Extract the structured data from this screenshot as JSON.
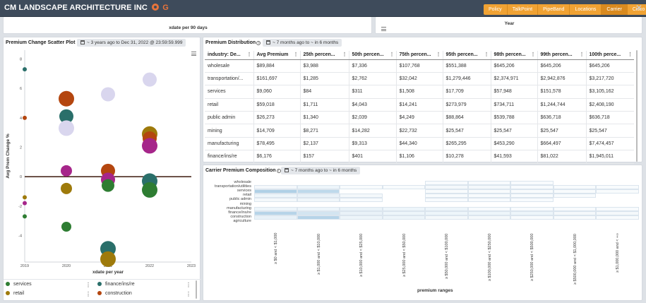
{
  "header": {
    "title": "CM LANDSCAPE ARCHITECTURE INC",
    "brand_icon": "orange-ring-logo",
    "brand_letter": "G",
    "tabs": [
      "Policy",
      "TalkPoint",
      "PipeBand",
      "Locations",
      "Carrier",
      "Cisco"
    ],
    "active_tab": "Carrier",
    "close": "✕"
  },
  "top_cards": {
    "left_axis_label": "xdate per 90 days",
    "right_axis_label": "Year"
  },
  "scatter": {
    "title": "Premium Change Scatter Plot",
    "date_range": "~ 3 years ago to Dec 31, 2022 @ 23:59:59.999",
    "legend": [
      {
        "label": "services",
        "color": "#2e7d32"
      },
      {
        "label": "finance/ins/re",
        "color": "#2a6f6a"
      },
      {
        "label": "retail",
        "color": "#9e7a0b"
      },
      {
        "label": "construction",
        "color": "#b4460f"
      }
    ]
  },
  "premium_distribution": {
    "title": "Premium Distribution",
    "date_range": "~ 7 months ago to ~ in 6 months",
    "columns": [
      "industry: De...",
      "Avg Premium",
      "25th percen...",
      "50th percen...",
      "75th percen...",
      "95th percen...",
      "98th percen...",
      "99th percen...",
      "100th perce..."
    ],
    "rows": [
      [
        "wholesale",
        "$89,884",
        "$3,988",
        "$7,336",
        "$107,768",
        "$551,388",
        "$645,206",
        "$645,206",
        "$645,206"
      ],
      [
        "transportation/...",
        "$161,697",
        "$1,285",
        "$2,762",
        "$32,042",
        "$1,279,446",
        "$2,374,971",
        "$2,942,876",
        "$3,217,720"
      ],
      [
        "services",
        "$9,060",
        "$84",
        "$311",
        "$1,508",
        "$17,709",
        "$57,948",
        "$151,578",
        "$3,105,162"
      ],
      [
        "retail",
        "$59,018",
        "$1,711",
        "$4,043",
        "$14,241",
        "$273,979",
        "$734,711",
        "$1,244,744",
        "$2,408,190"
      ],
      [
        "public admin",
        "$26,273",
        "$1,340",
        "$2,039",
        "$4,249",
        "$88,864",
        "$539,788",
        "$636,718",
        "$636,718"
      ],
      [
        "mining",
        "$14,709",
        "$8,271",
        "$14,282",
        "$22,732",
        "$25,547",
        "$25,547",
        "$25,547",
        "$25,547"
      ],
      [
        "manufacturing",
        "$78,495",
        "$2,137",
        "$9,313",
        "$44,340",
        "$265,295",
        "$453,290",
        "$664,497",
        "$7,474,457"
      ],
      [
        "finance/ins/re",
        "$6,176",
        "$157",
        "$401",
        "$1,106",
        "$10,278",
        "$41,593",
        "$81,022",
        "$1,945,011"
      ]
    ]
  },
  "carrier_composition": {
    "title": "Carrier Premium Composition",
    "date_range": "~ 7 months ago to ~ in 6 months"
  },
  "chart_data": [
    {
      "type": "scatter",
      "xlabel": "xdate per year",
      "ylabel": "Avg Prem Change %",
      "x_ticks": [
        "2019",
        "2020",
        "2021",
        "2022",
        "2023"
      ],
      "y_ticks": [
        -4,
        -2,
        0,
        2,
        4,
        6,
        8
      ],
      "ylim": [
        -5.8,
        8.6
      ],
      "reference_line_y": 0,
      "points": [
        {
          "x": 2019,
          "y": 7.3,
          "size": 3,
          "color": "#2a6f6a"
        },
        {
          "x": 2019,
          "y": 4.0,
          "size": 3,
          "color": "#b4460f"
        },
        {
          "x": 2019,
          "y": -1.4,
          "size": 3,
          "color": "#9e7a0b"
        },
        {
          "x": 2019,
          "y": -1.8,
          "size": 3,
          "color": "#a6268a"
        },
        {
          "x": 2019,
          "y": -2.7,
          "size": 3,
          "color": "#2e7d32"
        },
        {
          "x": 2020,
          "y": 5.3,
          "size": 11,
          "color": "#b4460f"
        },
        {
          "x": 2020,
          "y": 4.1,
          "size": 10,
          "color": "#2a6f6a"
        },
        {
          "x": 2020,
          "y": 3.3,
          "size": 11,
          "color": "#d9d6ee"
        },
        {
          "x": 2020,
          "y": 0.4,
          "size": 8,
          "color": "#a6268a"
        },
        {
          "x": 2020,
          "y": -0.8,
          "size": 8,
          "color": "#9e7a0b"
        },
        {
          "x": 2020,
          "y": -3.4,
          "size": 7,
          "color": "#2e7d32"
        },
        {
          "x": 2021,
          "y": 5.6,
          "size": 10,
          "color": "#d9d6ee"
        },
        {
          "x": 2021,
          "y": 0.4,
          "size": 10,
          "color": "#b4460f"
        },
        {
          "x": 2021,
          "y": -0.2,
          "size": 10,
          "color": "#a6268a"
        },
        {
          "x": 2021,
          "y": -0.6,
          "size": 9,
          "color": "#2e7d32"
        },
        {
          "x": 2021,
          "y": -4.9,
          "size": 11,
          "color": "#2a6f6a"
        },
        {
          "x": 2021,
          "y": -5.6,
          "size": 11,
          "color": "#9e7a0b"
        },
        {
          "x": 2022,
          "y": 6.6,
          "size": 10,
          "color": "#d9d6ee"
        },
        {
          "x": 2022,
          "y": 2.9,
          "size": 11,
          "color": "#9e7a0b"
        },
        {
          "x": 2022,
          "y": 2.6,
          "size": 10,
          "color": "#b4460f"
        },
        {
          "x": 2022,
          "y": 2.1,
          "size": 11,
          "color": "#a6268a"
        },
        {
          "x": 2022,
          "y": -0.3,
          "size": 11,
          "color": "#2a6f6a"
        },
        {
          "x": 2022,
          "y": -0.9,
          "size": 11,
          "color": "#2e7d32"
        }
      ]
    },
    {
      "type": "heatmap",
      "xlabel": "premium ranges",
      "rows": [
        "wholesale",
        "transportation/utilities",
        "services",
        "retail",
        "public admin",
        "mining",
        "manufacturing",
        "finance/ins/re",
        "construction",
        "agriculture"
      ],
      "columns": [
        "≥ $0 and < $1,000",
        "≥ $1,000 and < $10,000",
        "≥ $10,000 and < $25,000",
        "≥ $25,000 and < $50,000",
        "≥ $50,000 and < $100,000",
        "≥ $100,000 and < $250,000",
        "≥ $250,000 and < $500,000",
        "≥ $500,000 and < $1,000,000",
        "≥ $1,000,000 and < +∞"
      ],
      "values": [
        [
          0,
          0,
          0,
          0,
          0.05,
          0.05,
          0.05,
          0,
          0
        ],
        [
          0.08,
          0.12,
          0.05,
          0.05,
          0.08,
          0.08,
          0.05,
          0.05,
          0.05
        ],
        [
          0.55,
          0.45,
          0,
          0,
          0.05,
          0.05,
          0.05,
          0.05,
          0.05
        ],
        [
          0.12,
          0.15,
          0.08,
          0,
          0.05,
          0.05,
          0.05,
          0.05,
          0
        ],
        [
          0.08,
          0.1,
          0.05,
          0,
          0.05,
          0.05,
          0.05,
          0,
          0
        ],
        [
          0,
          0,
          0,
          0,
          0,
          0,
          0,
          0,
          0
        ],
        [
          0.12,
          0.12,
          0.15,
          0.12,
          0.12,
          0.05,
          0.05,
          0.05,
          0.05
        ],
        [
          0.5,
          0.3,
          0.15,
          0.12,
          0.12,
          0.12,
          0.12,
          0.08,
          0.08
        ],
        [
          0.15,
          0.5,
          0.12,
          0.12,
          0.08,
          0.08,
          0.05,
          0.05,
          0.05
        ],
        [
          0,
          0,
          0,
          0,
          0,
          0,
          0,
          0,
          0
        ]
      ]
    }
  ]
}
